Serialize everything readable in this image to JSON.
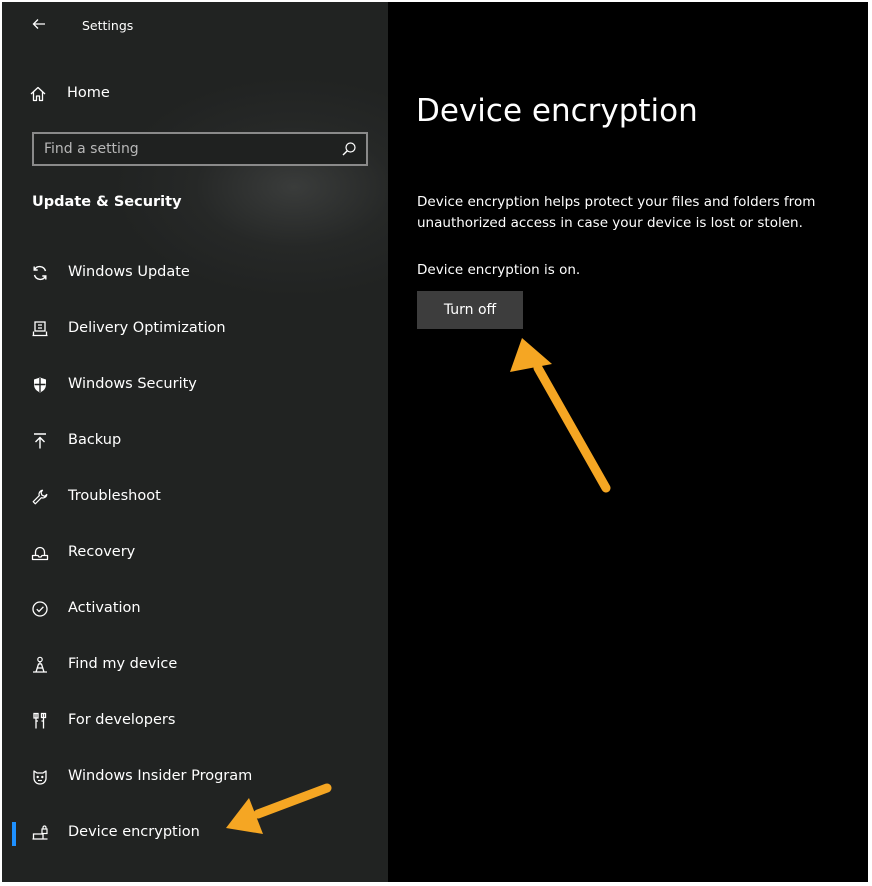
{
  "window": {
    "title": "Settings",
    "back_icon": "back-arrow-icon"
  },
  "sidebar": {
    "home": {
      "label": "Home",
      "icon": "home-icon"
    },
    "search": {
      "placeholder": "Find a setting",
      "value": "",
      "icon": "search-icon"
    },
    "section_title": "Update & Security",
    "items": [
      {
        "label": "Windows Update",
        "icon": "sync-icon",
        "selected": false
      },
      {
        "label": "Delivery Optimization",
        "icon": "delivery-optimization-icon",
        "selected": false
      },
      {
        "label": "Windows Security",
        "icon": "shield-icon",
        "selected": false
      },
      {
        "label": "Backup",
        "icon": "backup-icon",
        "selected": false
      },
      {
        "label": "Troubleshoot",
        "icon": "wrench-icon",
        "selected": false
      },
      {
        "label": "Recovery",
        "icon": "recovery-icon",
        "selected": false
      },
      {
        "label": "Activation",
        "icon": "check-circle-icon",
        "selected": false
      },
      {
        "label": "Find my device",
        "icon": "find-device-icon",
        "selected": false
      },
      {
        "label": "For developers",
        "icon": "developer-tools-icon",
        "selected": false
      },
      {
        "label": "Windows Insider Program",
        "icon": "insider-icon",
        "selected": false
      },
      {
        "label": "Device encryption",
        "icon": "device-encryption-icon",
        "selected": true
      }
    ],
    "selection_color": "#1e90ff"
  },
  "main": {
    "page_title": "Device encryption",
    "description": "Device encryption helps protect your files and folders from unauthorized access in case your device is lost or stolen.",
    "status": "Device encryption is on.",
    "turn_off_label": "Turn off"
  },
  "annotations": {
    "arrow_color": "#f5a623"
  }
}
